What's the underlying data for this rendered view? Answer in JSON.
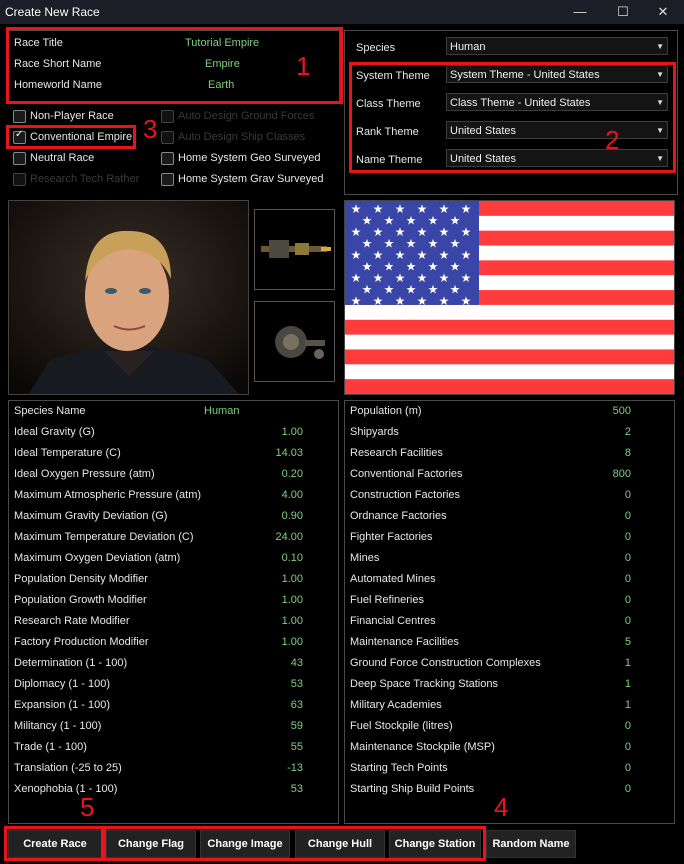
{
  "window": {
    "title": "Create New Race"
  },
  "race_info": [
    {
      "label": "Race Title",
      "value": "Tutorial Empire"
    },
    {
      "label": "Race Short Name",
      "value": "Empire"
    },
    {
      "label": "Homeworld Name",
      "value": "Earth"
    }
  ],
  "themes": {
    "species": {
      "label": "Species",
      "value": "Human"
    },
    "system": {
      "label": "System Theme",
      "value": "System Theme - United States"
    },
    "class": {
      "label": "Class Theme",
      "value": "Class Theme - United States"
    },
    "rank": {
      "label": "Rank Theme",
      "value": "United States"
    },
    "name": {
      "label": "Name Theme",
      "value": "United States"
    }
  },
  "checkboxes": {
    "non_player": {
      "label": "Non-Player Race",
      "checked": false
    },
    "conventional": {
      "label": "Conventional Empire",
      "checked": true
    },
    "neutral": {
      "label": "Neutral Race",
      "checked": false
    },
    "research_tech": {
      "label": "Research Tech Rather",
      "checked": false
    },
    "auto_ground": {
      "label": "Auto Design Ground Forces",
      "checked": false
    },
    "auto_ships": {
      "label": "Auto Design Ship Classes",
      "checked": false
    },
    "geo": {
      "label": "Home System Geo Surveyed",
      "checked": false
    },
    "grav": {
      "label": "Home System Grav Surveyed",
      "checked": false
    }
  },
  "species_stats": [
    {
      "label": "Species Name",
      "value": "Human"
    },
    {
      "label": "Ideal Gravity (G)",
      "value": "1.00"
    },
    {
      "label": "Ideal Temperature (C)",
      "value": "14.03"
    },
    {
      "label": "Ideal Oxygen Pressure (atm)",
      "value": "0.20"
    },
    {
      "label": "Maximum Atmospheric Pressure (atm)",
      "value": "4.00"
    },
    {
      "label": "Maximum Gravity Deviation (G)",
      "value": "0.90"
    },
    {
      "label": "Maximum Temperature Deviation (C)",
      "value": "24.00"
    },
    {
      "label": "Maximum Oxygen Deviation (atm)",
      "value": "0.10"
    },
    {
      "label": "Population Density Modifier",
      "value": "1.00"
    },
    {
      "label": "Population Growth Modifier",
      "value": "1.00"
    },
    {
      "label": "Research Rate Modifier",
      "value": "1.00"
    },
    {
      "label": "Factory Production Modifier",
      "value": "1.00"
    },
    {
      "label": "Determination (1 - 100)",
      "value": "43"
    },
    {
      "label": "Diplomacy (1 - 100)",
      "value": "53"
    },
    {
      "label": "Expansion (1 - 100)",
      "value": "63"
    },
    {
      "label": "Militancy (1 - 100)",
      "value": "59"
    },
    {
      "label": "Trade (1 - 100)",
      "value": "55"
    },
    {
      "label": "Translation (-25 to 25)",
      "value": "-13"
    },
    {
      "label": "Xenophobia (1 - 100)",
      "value": "53"
    }
  ],
  "colony_stats": [
    {
      "label": "Population (m)",
      "value": "500"
    },
    {
      "label": "Shipyards",
      "value": "2"
    },
    {
      "label": "Research Facilities",
      "value": "8"
    },
    {
      "label": "Conventional Factories",
      "value": "800"
    },
    {
      "label": "Construction Factories",
      "value": "0"
    },
    {
      "label": "Ordnance Factories",
      "value": "0"
    },
    {
      "label": "Fighter Factories",
      "value": "0"
    },
    {
      "label": "Mines",
      "value": "0"
    },
    {
      "label": "Automated Mines",
      "value": "0"
    },
    {
      "label": "Fuel Refineries",
      "value": "0"
    },
    {
      "label": "Financial Centres",
      "value": "0"
    },
    {
      "label": "Maintenance Facilities",
      "value": "5"
    },
    {
      "label": "Ground Force Construction Complexes",
      "value": "1"
    },
    {
      "label": "Deep Space Tracking Stations",
      "value": "1"
    },
    {
      "label": "Military Academies",
      "value": "1"
    },
    {
      "label": "Fuel Stockpile (litres)",
      "value": "0"
    },
    {
      "label": "Maintenance Stockpile (MSP)",
      "value": "0"
    },
    {
      "label": "Starting Tech Points",
      "value": "0"
    },
    {
      "label": "Starting Ship Build Points",
      "value": "0"
    }
  ],
  "buttons": {
    "create": "Create Race",
    "flag": "Change Flag",
    "image": "Change Image",
    "hull": "Change Hull",
    "station": "Change Station",
    "random": "Random Name"
  },
  "annotations": [
    "1",
    "2",
    "3",
    "4",
    "5"
  ],
  "colors": {
    "accent_green": "#7fd07f",
    "highlight_red": "#e8141a",
    "flag_red": "#ff3b3b",
    "flag_blue": "#3a45a8"
  }
}
